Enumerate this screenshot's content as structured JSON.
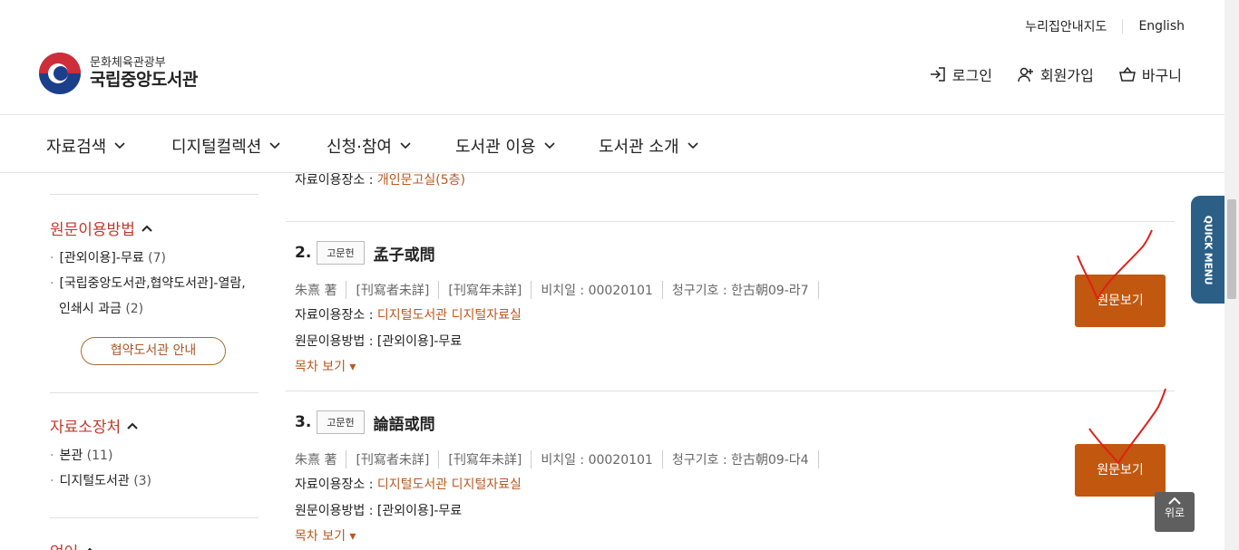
{
  "util": {
    "sitemap": "누리집안내지도",
    "english": "English"
  },
  "logo": {
    "ministry": "문화체육관광부",
    "library": "국립중앙도서관"
  },
  "usermenu": {
    "login": "로그인",
    "join": "회원가입",
    "cart": "바구니"
  },
  "gnb": [
    "자료검색",
    "디지털컬렉션",
    "신청·참여",
    "도서관 이용",
    "도서관 소개"
  ],
  "sidebar": {
    "facet_method": {
      "title": "원문이용방법",
      "items": [
        {
          "label": "[관외이용]-무료",
          "count": "(7)"
        },
        {
          "label": "[국립중앙도서관,협약도서관]-열람,",
          "label2": "인쇄시 과금",
          "count": "(2)"
        }
      ],
      "button": "협약도서관 안내"
    },
    "facet_location": {
      "title": "자료소장처",
      "items": [
        {
          "label": "본관",
          "count": "(11)"
        },
        {
          "label": "디지털도서관",
          "count": "(3)"
        }
      ]
    },
    "facet_language": {
      "title": "언어"
    }
  },
  "results": {
    "prev_location_label": "자료이용장소 :",
    "prev_location_value": "개인문고실(5층)",
    "items": [
      {
        "num": "2.",
        "badge": "고문헌",
        "title": "孟子或問",
        "meta": [
          "朱熹 著",
          "[刊寫者未詳]",
          "[刊寫年未詳]",
          "비치일 : 00020101",
          "청구기호 : 한古朝09-라7"
        ],
        "location_label": "자료이용장소 :",
        "location_value": "디지털도서관 디지털자료실",
        "method_label": "원문이용방법 :",
        "method_value": "[관외이용]-무료",
        "toc": "목차 보기 ▾",
        "view_button": "원문보기"
      },
      {
        "num": "3.",
        "badge": "고문헌",
        "title": "論語或問",
        "meta": [
          "朱熹 著",
          "[刊寫者未詳]",
          "[刊寫年未詳]",
          "비치일 : 00020101",
          "청구기호 : 한古朝09-다4"
        ],
        "location_label": "자료이용장소 :",
        "location_value": "디지털도서관 디지털자료실",
        "method_label": "원문이용방법 :",
        "method_value": "[관외이용]-무료",
        "toc": "목차 보기 ▾",
        "view_button": "원문보기"
      }
    ]
  },
  "quick_menu": "QUICK MENU",
  "to_top": "위로",
  "colors": {
    "accent": "#c2570f",
    "facet_title": "#c0392b",
    "link": "#b9581e",
    "quick": "#2b5f86"
  }
}
